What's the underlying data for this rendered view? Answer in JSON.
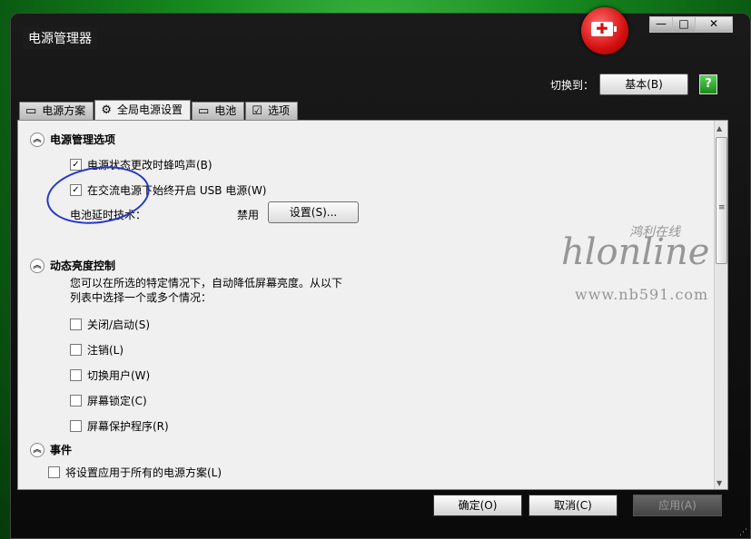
{
  "window": {
    "title": "电源管理器",
    "controls": {
      "minimize": "—",
      "maximize": "□",
      "close": "✕"
    }
  },
  "header": {
    "switch_label": "切换到：",
    "switch_button": "基本(B)",
    "help": "?"
  },
  "tabs": [
    {
      "label": "电源方案",
      "icon": "battery-outline-icon"
    },
    {
      "label": "全局电源设置",
      "icon": "gear-icon",
      "active": true
    },
    {
      "label": "电池",
      "icon": "battery-icon"
    },
    {
      "label": "选项",
      "icon": "checkbox-icon"
    }
  ],
  "power_section": {
    "title": "电源管理选项",
    "items": [
      {
        "label": "电源状态更改时蜂鸣声(B)",
        "checked": true
      },
      {
        "label": "在交流电源下始终开启 USB 电源(W)",
        "checked": true
      }
    ],
    "battery_tech_label": "电池延时技术：",
    "battery_tech_value": "禁用",
    "settings_button": "设置(S)..."
  },
  "brightness_section": {
    "title": "动态亮度控制",
    "desc_line1": "您可以在所选的特定情况下，自动降低屏幕亮度。从以下",
    "desc_line2": "列表中选择一个或多个情况：",
    "items": [
      {
        "label": "关闭/启动(S)",
        "checked": false
      },
      {
        "label": "注销(L)",
        "checked": false
      },
      {
        "label": "切换用户(W)",
        "checked": false
      },
      {
        "label": "屏幕锁定(C)",
        "checked": false
      },
      {
        "label": "屏幕保护程序(R)",
        "checked": false
      }
    ]
  },
  "events_section": {
    "title": "事件",
    "items": [
      {
        "label": "将设置应用于所有的电源方案(L)",
        "checked": false
      }
    ]
  },
  "footer": {
    "ok": "确定(O)",
    "cancel": "取消(C)",
    "apply": "应用(A)"
  },
  "watermark": {
    "logo": "hlonline",
    "cn": "鸿利在线",
    "url": "www.nb591.com"
  }
}
